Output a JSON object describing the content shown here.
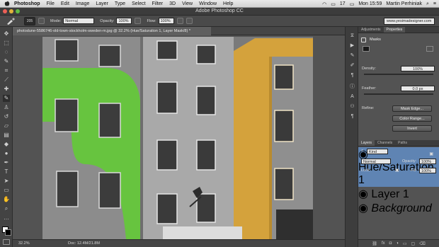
{
  "menubar": {
    "app": "Photoshop",
    "items": [
      "File",
      "Edit",
      "Image",
      "Layer",
      "Type",
      "Select",
      "Filter",
      "3D",
      "View",
      "Window",
      "Help"
    ],
    "battery": "17",
    "time": "Mon 15:59",
    "user": "Martin Perhiniak"
  },
  "window": {
    "title": "Adobe Photoshop CC"
  },
  "options": {
    "brush_size": "205",
    "mode_label": "Mode:",
    "mode_value": "Normal",
    "opacity_label": "Opacity:",
    "opacity_value": "100%",
    "flow_label": "Flow:",
    "flow_value": "100%",
    "workspace": "www.yesimadesigner.com"
  },
  "document": {
    "tab_title": "photodune-5586746-old-town-stockholm-sweden-m.jpg @ 32.2% (Hue/Saturation 1, Layer Mask/8) *",
    "zoom": "32.2%",
    "doc_size": "Doc: 12.4M/21.8M"
  },
  "properties": {
    "tabs": [
      "Adjustments",
      "Properties"
    ],
    "masks_label": "Masks",
    "density_label": "Density:",
    "density_value": "100%",
    "feather_label": "Feather:",
    "feather_value": "0.0 px",
    "refine_label": "Refine:",
    "mask_edge_btn": "Mask Edge...",
    "color_range_btn": "Color Range...",
    "invert_btn": "Invert"
  },
  "layers": {
    "tabs": [
      "Layers",
      "Channels",
      "Paths"
    ],
    "kind_label": "Kind",
    "blend_mode": "Normal",
    "opacity_label": "Opacity:",
    "opacity_value": "100%",
    "lock_label": "Lock:",
    "fill_label": "Fill:",
    "fill_value": "100%",
    "items": [
      {
        "name": "Hue/Saturation 1"
      },
      {
        "name": "Layer 1"
      },
      {
        "name": "Background"
      }
    ]
  },
  "colors": {
    "mask_overlay": "#5fd12e",
    "yellow_building": "#d9a93a",
    "selected_layer": "#5f84b3"
  },
  "icons": {
    "apple": "apple-icon",
    "wifi": "wifi-icon",
    "search": "search-icon",
    "eye": "eye-icon",
    "lock": "lock-icon",
    "brush": "brush-icon"
  }
}
